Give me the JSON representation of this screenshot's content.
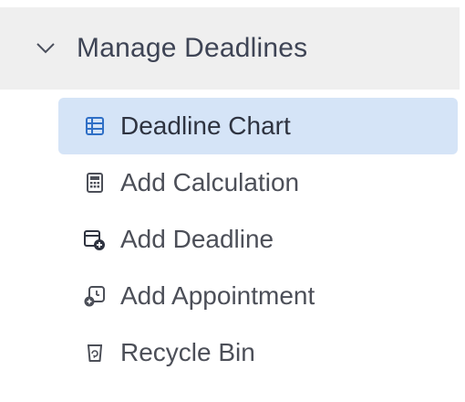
{
  "section": {
    "title": "Manage Deadlines",
    "expanded": true,
    "icon": "chevron-down-icon"
  },
  "menu": {
    "items": [
      {
        "label": "Deadline Chart",
        "icon": "table-icon",
        "active": true
      },
      {
        "label": "Add Calculation",
        "icon": "calculator-icon",
        "active": false
      },
      {
        "label": "Add Deadline",
        "icon": "calendar-add-icon",
        "active": false
      },
      {
        "label": "Add Appointment",
        "icon": "appointment-add-icon",
        "active": false
      },
      {
        "label": "Recycle Bin",
        "icon": "recycle-bin-icon",
        "active": false
      }
    ]
  },
  "colors": {
    "header_bg": "#efefef",
    "active_bg": "#d5e4f7",
    "accent": "#2f6fc6",
    "text": "#4c4f58"
  }
}
